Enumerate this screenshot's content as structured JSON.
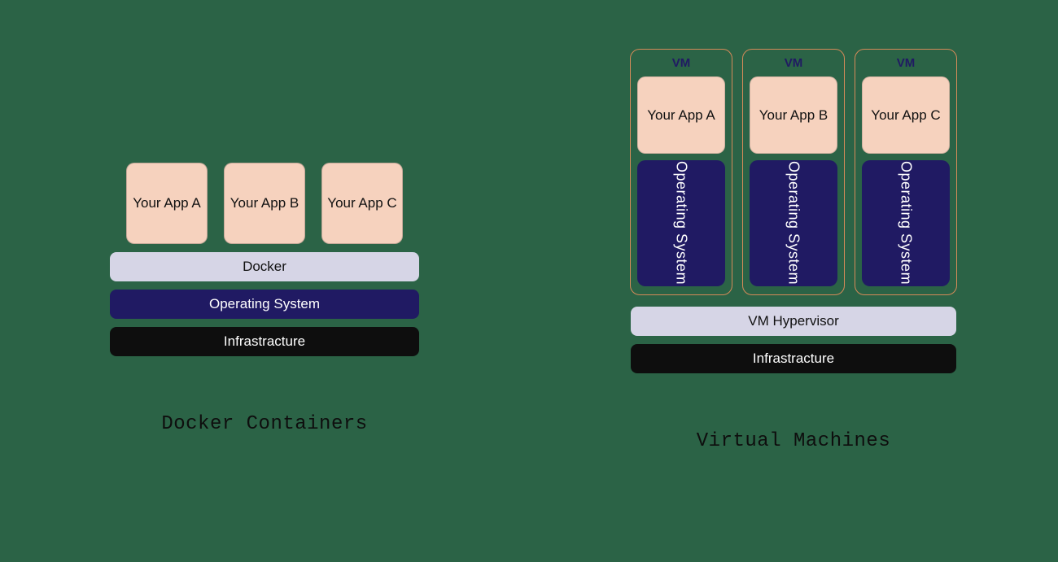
{
  "docker": {
    "apps": [
      "Your App A",
      "Your App B",
      "Your App C"
    ],
    "layers": {
      "docker": "Docker",
      "os": "Operating System",
      "infra": "Infrastracture"
    },
    "caption": "Docker Containers"
  },
  "vm": {
    "vm_label": "VM",
    "vms": [
      {
        "app": "Your App A",
        "os": "Operating System"
      },
      {
        "app": "Your App B",
        "os": "Operating System"
      },
      {
        "app": "Your App C",
        "os": "Operating System"
      }
    ],
    "layers": {
      "hypervisor": "VM Hypervisor",
      "infra": "Infrastracture"
    },
    "caption": "Virtual Machines"
  }
}
